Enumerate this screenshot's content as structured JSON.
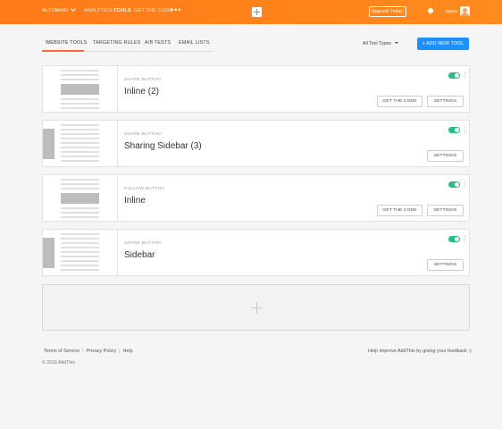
{
  "header": {
    "account": "ALTOMAIN",
    "nav": [
      "ANALYTICS",
      "TOOLS",
      "GET THE CODE"
    ],
    "active_nav": "TOOLS",
    "more": "•••",
    "upgrade": "Upgrade Today!",
    "username": "rajash"
  },
  "tabs": [
    "WEBSITE TOOLS",
    "TARGETING RULES",
    "A/B TESTS",
    "EMAIL LISTS"
  ],
  "active_tab": "WEBSITE TOOLS",
  "toolbar": {
    "filter": "All Tool Types",
    "add_tool": "+ ADD NEW TOOL"
  },
  "tools": [
    {
      "type": "SHARE BUTTON",
      "name": "Inline (2)",
      "enabled": true,
      "get_code": "GET THE CODE",
      "settings": "SETTINGS"
    },
    {
      "type": "SHARE BUTTON",
      "name": "Sharing Sidebar (3)",
      "enabled": true,
      "settings": "SETTINGS"
    },
    {
      "type": "FOLLOW BUTTON",
      "name": "Inline",
      "enabled": true,
      "get_code": "GET THE CODE",
      "settings": "SETTINGS"
    },
    {
      "type": "SHARE BUTTON",
      "name": "Sidebar",
      "enabled": true,
      "settings": "SETTINGS"
    }
  ],
  "footer": {
    "links": [
      "Terms of Service",
      "Privacy Policy",
      "Help"
    ],
    "separator": "|",
    "copyright": "© 2016 AddThis",
    "feedback": "Help improve AddThis by giving your feedback :)"
  },
  "colors": {
    "header": "#ff7a18",
    "primary_button": "#1e90ff",
    "toggle_on": "#2bbd7e",
    "tab_accent": "#ff6a3d"
  }
}
